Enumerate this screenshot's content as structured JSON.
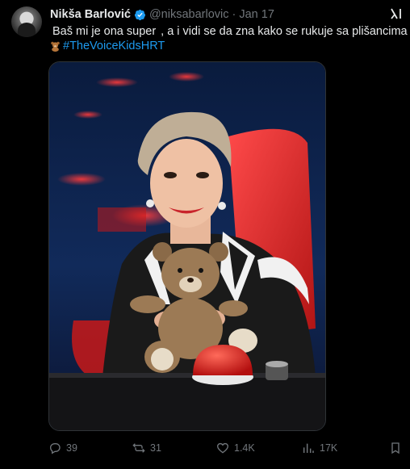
{
  "tweet": {
    "author_name": "Nikša Barlović",
    "handle": "@niksabarlovic",
    "separator": "·",
    "date": "Jan 17",
    "text_part1": "Baš mi je ona super",
    "text_part2": ", a i vidi se da zna kako se rukuje sa plišancima",
    "hashtag": "#TheVoiceKidsHRT"
  },
  "actions": {
    "replies": "39",
    "reposts": "31",
    "likes": "1.4K",
    "views": "17K"
  },
  "icons": [
    "verified-badge-icon",
    "grok-icon",
    "teddy-bear-emoji",
    "red-heart-emoji",
    "reply-icon",
    "repost-icon",
    "like-icon",
    "views-icon",
    "bookmark-icon"
  ],
  "colors": {
    "accent": "#1d9bf0",
    "muted": "#71767b",
    "text": "#e7e9ea",
    "background": "#000000"
  }
}
